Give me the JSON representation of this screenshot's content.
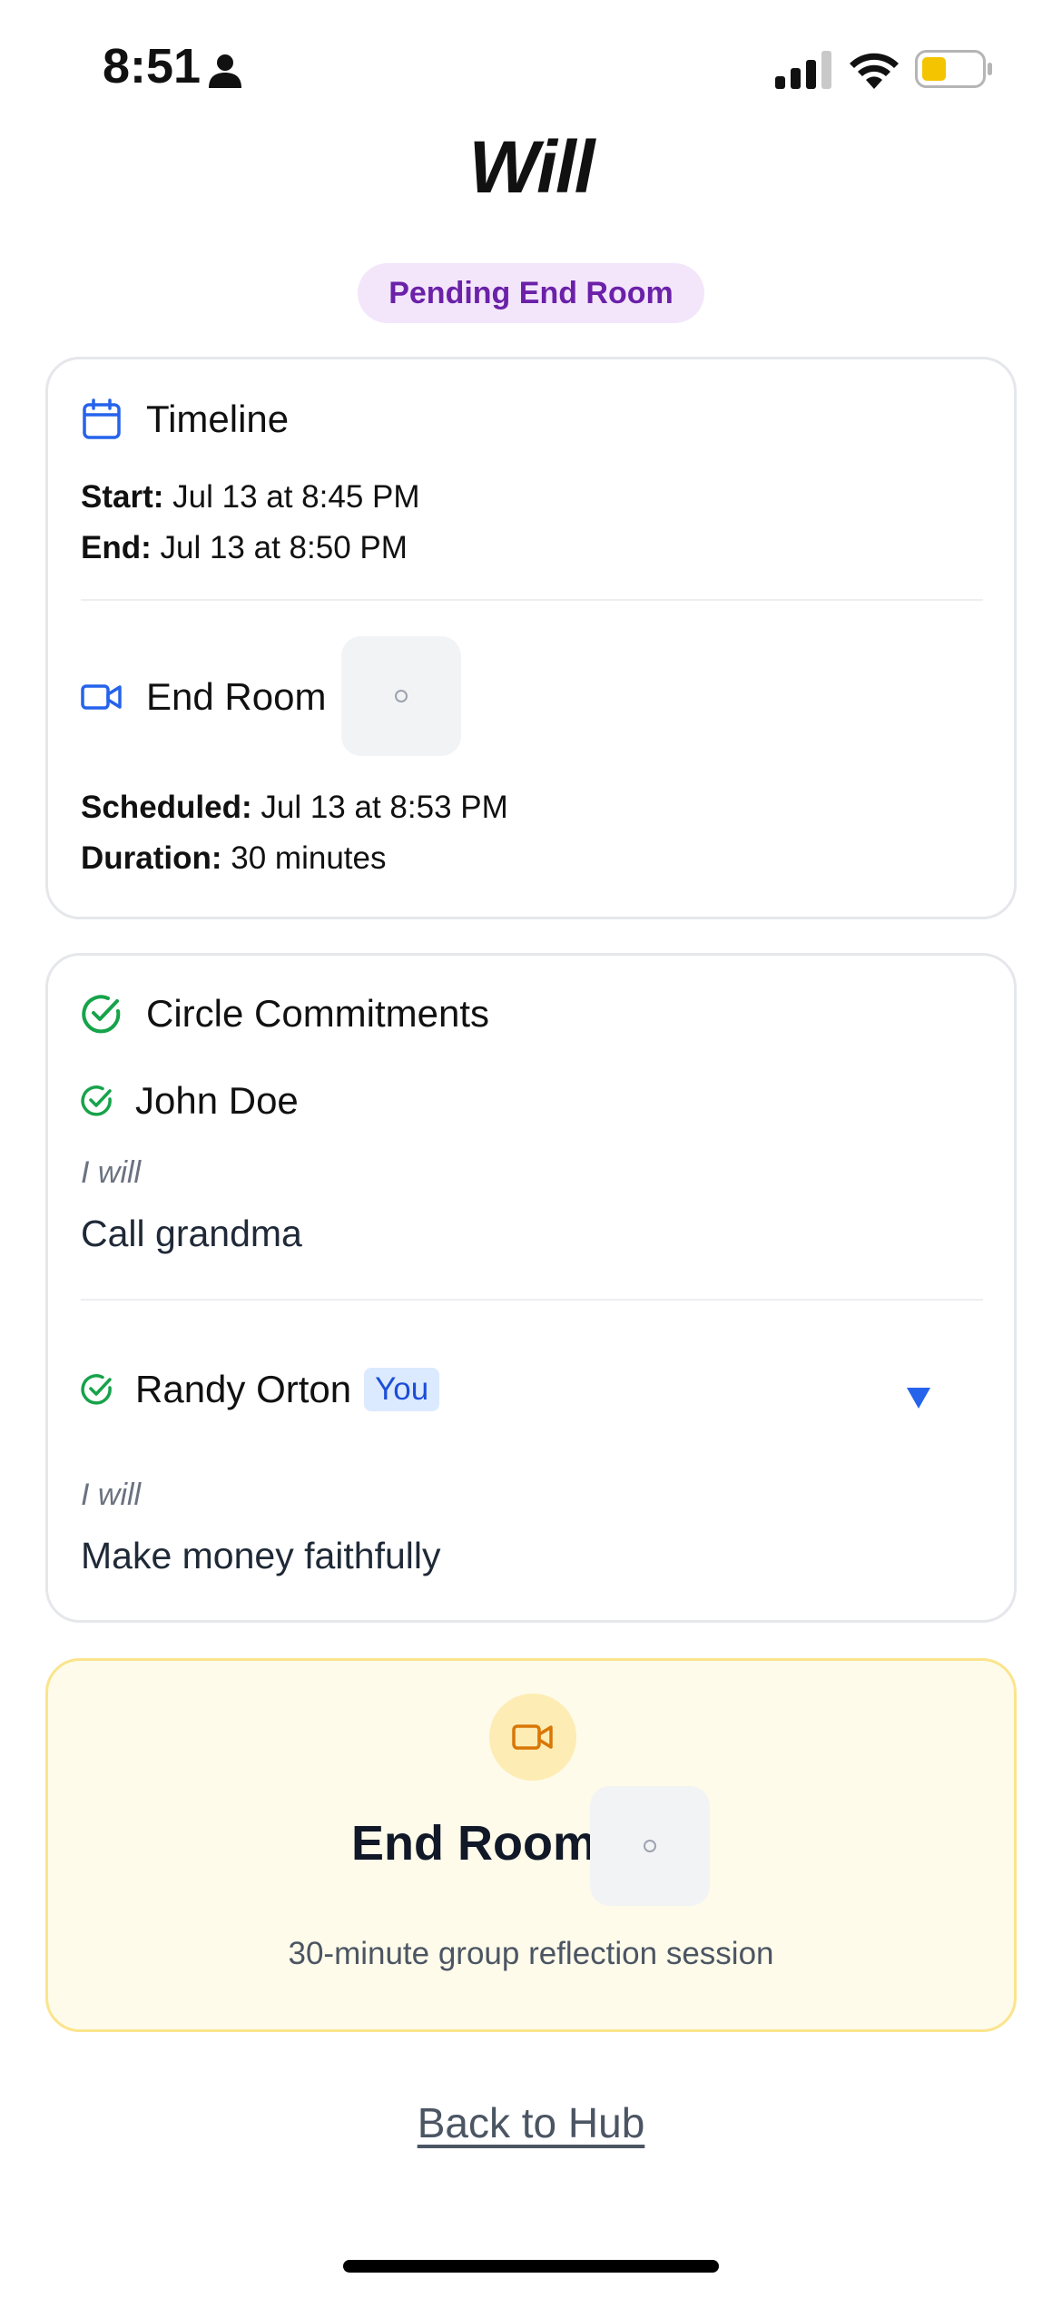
{
  "status_bar": {
    "time": "8:51",
    "icons": [
      "person-icon",
      "signal-icon",
      "wifi-icon",
      "battery-icon"
    ],
    "battery_color": "#f5c400"
  },
  "page": {
    "title": "Will",
    "status_pill": "Pending End Room"
  },
  "timeline": {
    "heading": "Timeline",
    "start_label": "Start:",
    "start_value": "Jul 13 at 8:45 PM",
    "end_label": "End:",
    "end_value": "Jul 13 at 8:50 PM",
    "end_room_heading": "End Room",
    "scheduled_label": "Scheduled:",
    "scheduled_value": "Jul 13 at 8:53 PM",
    "duration_label": "Duration:",
    "duration_value": "30 minutes"
  },
  "commitments": {
    "heading": "Circle Commitments",
    "members": [
      {
        "name": "John Doe",
        "i_will": "I will",
        "commitment": "Call grandma"
      },
      {
        "name": "Randy Orton",
        "badge": "You",
        "i_will": "I will",
        "commitment": "Make money faithfully"
      }
    ]
  },
  "end_room_card": {
    "title": "End Room",
    "subtitle": "30-minute group reflection session"
  },
  "footer": {
    "back_link": "Back to Hub"
  },
  "colors": {
    "accent_blue": "#2563eb",
    "accent_green": "#16a34a",
    "pill_bg": "#f3e6fb",
    "pill_text": "#6b21a8",
    "end_room_bg": "#fefbea",
    "end_room_icon": "#d97706"
  }
}
